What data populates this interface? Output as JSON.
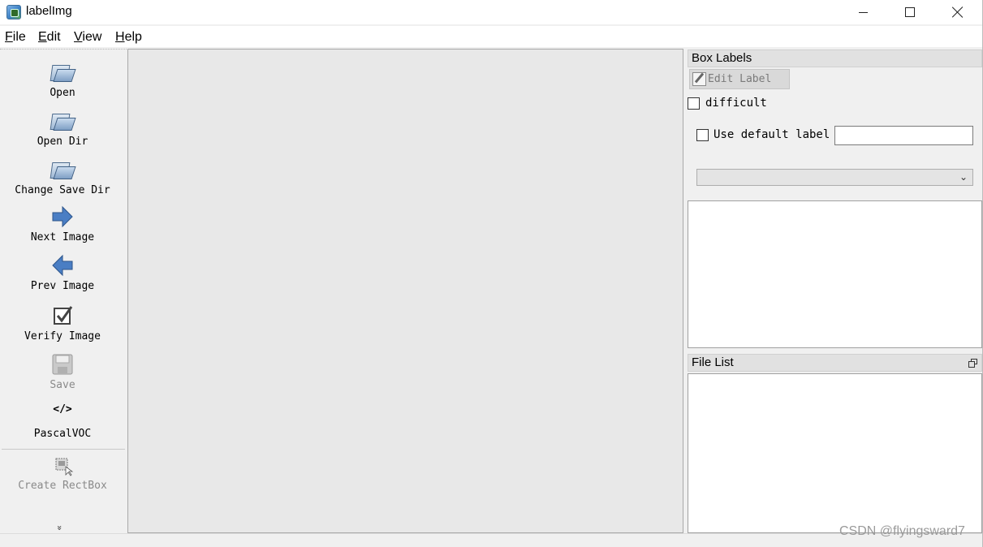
{
  "window": {
    "title": "labelImg",
    "icon": "labelimg-app-icon"
  },
  "menu": [
    {
      "key": "F",
      "rest": "ile"
    },
    {
      "key": "E",
      "rest": "dit"
    },
    {
      "key": "V",
      "rest": "iew"
    },
    {
      "key": "H",
      "rest": "elp"
    }
  ],
  "toolbar": {
    "open": "Open",
    "open_dir": "Open Dir",
    "change_save_dir": "Change Save Dir",
    "next_image": "Next Image",
    "prev_image": "Prev Image",
    "verify_image": "Verify Image",
    "save": "Save",
    "format_glyph": "</>",
    "format": "PascalVOC",
    "create_rectbox": "Create RectBox",
    "expand_glyph": "»"
  },
  "box_labels": {
    "title": "Box Labels",
    "edit_label": "Edit Label",
    "difficult": "difficult",
    "use_default_label": "Use default label",
    "default_label_value": "",
    "combo_value": ""
  },
  "file_list": {
    "title": "File List"
  },
  "watermark": "CSDN @flyingsward7",
  "colors": {
    "canvas_bg": "#e8e8e8",
    "dock_title_bg": "#e1e1e1",
    "window_bg": "#f0f0f0",
    "arrow_blue": "#4a7ec4"
  }
}
